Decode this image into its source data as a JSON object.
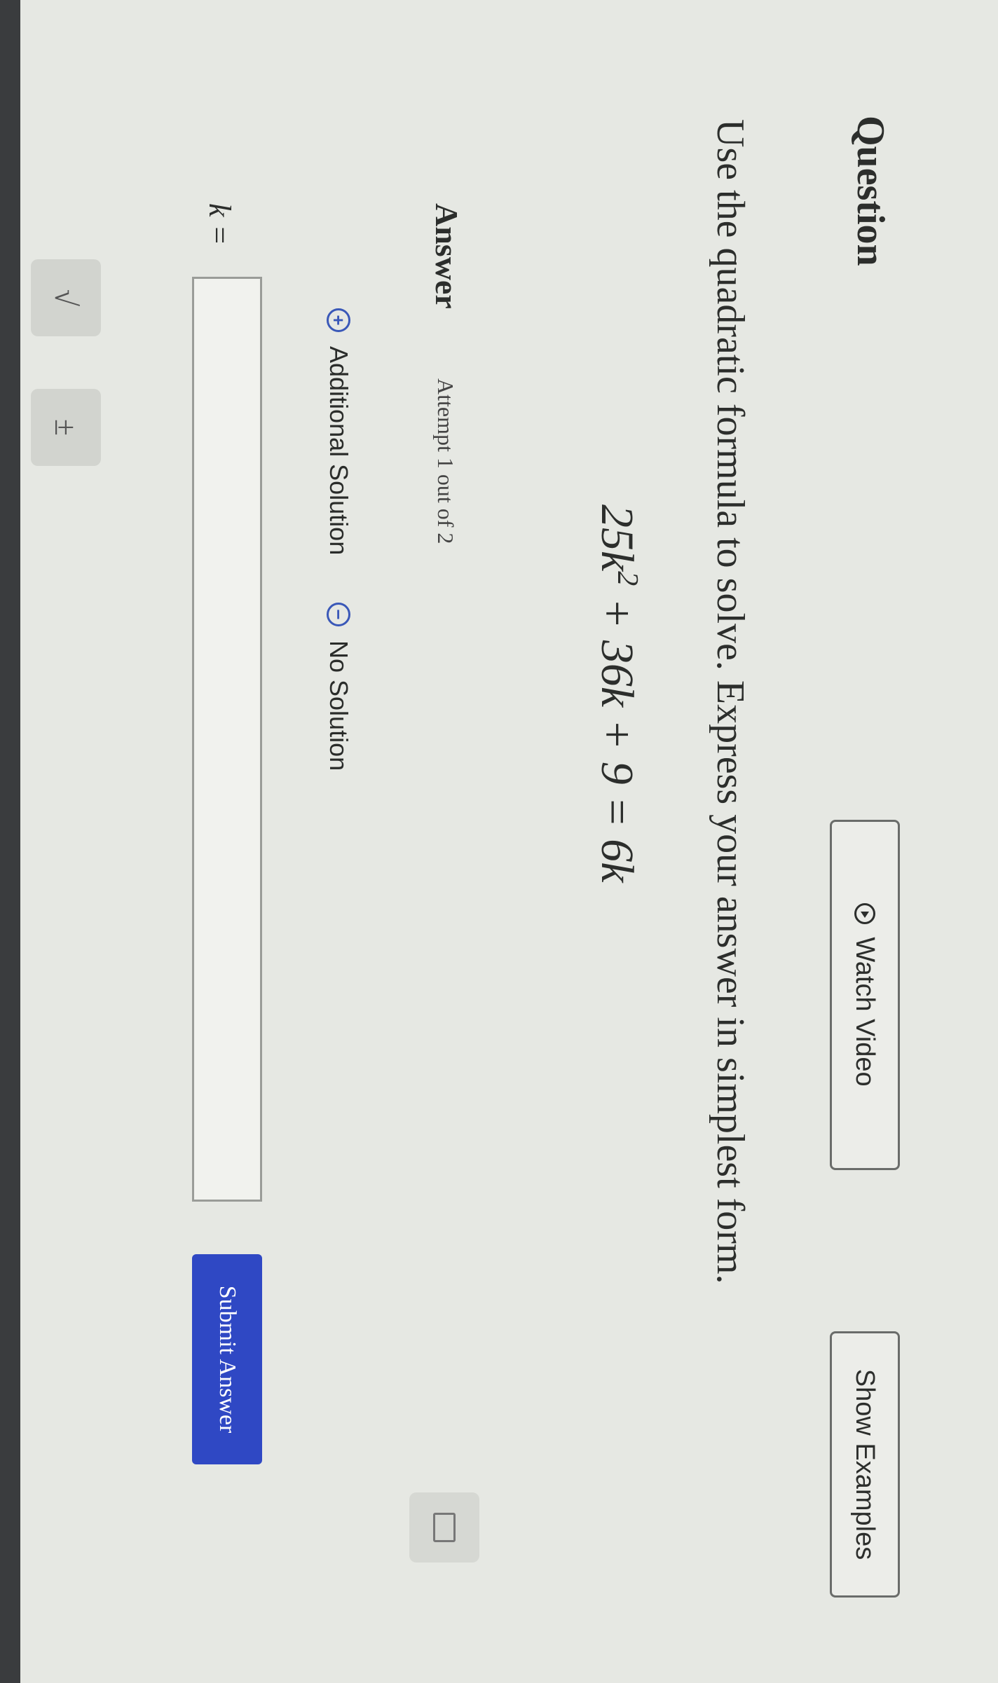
{
  "header": {
    "title": "Question",
    "watch_video_label": "Watch Video",
    "show_examples_label": "Show Examples"
  },
  "question": {
    "prompt": "Use the quadratic formula to solve. Express your answer in simplest form.",
    "equation": {
      "coef_a": "25k",
      "exponent": "2",
      "rest": " + 36k + 9 = 6k"
    }
  },
  "answer": {
    "heading": "Answer",
    "attempt": "Attempt 1 out of 2",
    "options": {
      "additional_solution": "Additional Solution",
      "no_solution": "No Solution"
    },
    "variable_label": "k =",
    "input_value": "",
    "submit_label": "Submit Answer"
  },
  "toolbar": {
    "sqrt_symbol": "√",
    "plus_minus_symbol": "±"
  },
  "icons": {
    "watch_video": "play-circle-icon",
    "additional_solution": "plus-circle-icon",
    "no_solution": "minus-circle-icon",
    "calculator": "keyboard-icon"
  },
  "colors": {
    "accent": "#2f48c4",
    "option_icon": "#3a58b8",
    "background": "#e6e8e3"
  }
}
